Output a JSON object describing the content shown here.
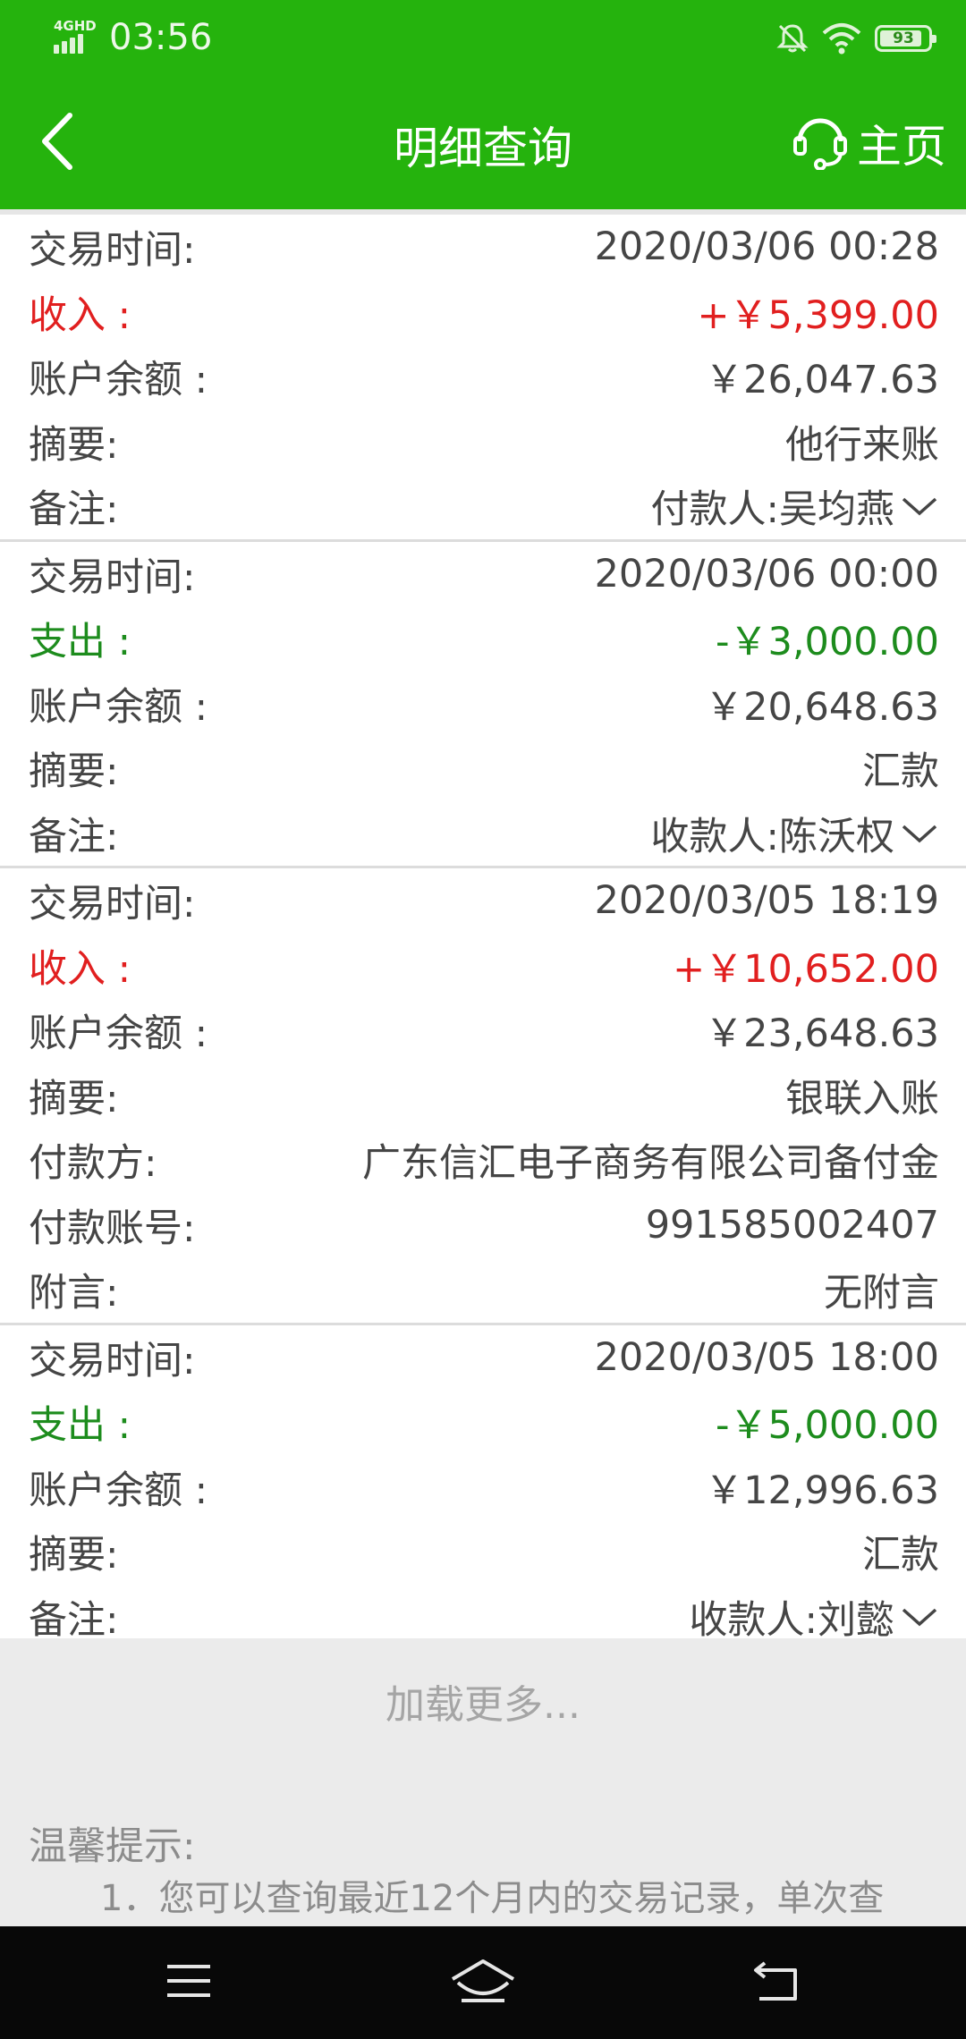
{
  "status_bar": {
    "network": "4GHD",
    "time": "03:56",
    "battery": "93",
    "colors": {
      "bar": "#25b30d"
    }
  },
  "header": {
    "title": "明细查询",
    "home_label": "主页",
    "icons": {
      "back": "chevron-left-icon",
      "home": "headset-icon"
    }
  },
  "records": [
    {
      "time_label": "交易时间:",
      "time": "2020/03/06 00:28",
      "type": "income",
      "amount_label": "收入 :",
      "amount": "+￥5,399.00",
      "balance_label": "账户余额 :",
      "balance": "￥26,047.63",
      "summary_label": "摘要:",
      "summary": "他行来账",
      "note_label": "备注:",
      "note": "付款人:吴均燕"
    },
    {
      "time_label": "交易时间:",
      "time": "2020/03/06 00:00",
      "type": "expense",
      "amount_label": "支出 :",
      "amount": "-￥3,000.00",
      "balance_label": "账户余额 :",
      "balance": "￥20,648.63",
      "summary_label": "摘要:",
      "summary": "汇款",
      "note_label": "备注:",
      "note": "收款人:陈沃权"
    },
    {
      "time_label": "交易时间:",
      "time": "2020/03/05 18:19",
      "type": "income",
      "amount_label": "收入 :",
      "amount": "+￥10,652.00",
      "balance_label": "账户余额 :",
      "balance": "￥23,648.63",
      "summary_label": "摘要:",
      "summary": "银联入账",
      "payer_label": "付款方:",
      "payer": "广东信汇电子商务有限公司备付金",
      "payer_account_label": "付款账号:",
      "payer_account": "991585002407",
      "postscript_label": "附言:",
      "postscript": "无附言"
    },
    {
      "time_label": "交易时间:",
      "time": "2020/03/05 18:00",
      "type": "expense",
      "amount_label": "支出 :",
      "amount": "-￥5,000.00",
      "balance_label": "账户余额 :",
      "balance": "￥12,996.63",
      "summary_label": "摘要:",
      "summary": "汇款",
      "note_label": "备注:",
      "note": "收款人:刘懿"
    }
  ],
  "load_more": "加载更多...",
  "tips": {
    "title": "温馨提示:",
    "line1": "1．您可以查询最近12个月内的交易记录，单次查"
  },
  "colors": {
    "income": "#e11f1f",
    "expense": "#1d8c1d",
    "text": "#454545",
    "header": "#25b30d"
  },
  "nav_icons": [
    "menu-icon",
    "home-icon",
    "back-icon"
  ]
}
